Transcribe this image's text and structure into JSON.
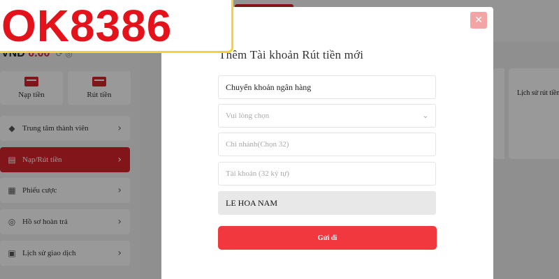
{
  "brand": {
    "logo_text": "OK8386",
    "accent": "#d8232a",
    "logo_border": "#f3d23a"
  },
  "account": {
    "currency": "VND",
    "balance": "0.00",
    "tool_icons": "⟳ ◎"
  },
  "quick_actions": [
    {
      "label": "Nạp tiền",
      "icon": "wallet-in-icon"
    },
    {
      "label": "Rút tiền",
      "icon": "wallet-out-icon"
    }
  ],
  "menu": [
    {
      "label": "Trung tâm thành viên",
      "icon": "diamond-icon",
      "active": false
    },
    {
      "label": "Nạp/Rút tiền",
      "icon": "card-icon",
      "active": true
    },
    {
      "label": "Phiếu cược",
      "icon": "ticket-icon",
      "active": false
    },
    {
      "label": "Hồ sơ hoàn trả",
      "icon": "refund-icon",
      "active": false
    },
    {
      "label": "Lịch sử giao dịch",
      "icon": "calendar-icon",
      "active": false
    }
  ],
  "history_card": {
    "label": "Lịch sử rút tiền"
  },
  "modal": {
    "title": "Thêm Tài khoản Rút tiền mới",
    "close_symbol": "✕",
    "bank_type": "Chuyển khoản ngân hàng",
    "bank_select_placeholder": "Vui lòng chọn",
    "branch_placeholder": "Chi nhánh(Chọn 32)",
    "account_placeholder": "Tài khoản (32 ký tự)",
    "account_holder": "LE HOA NAM",
    "submit_label": "Gửi đi"
  }
}
